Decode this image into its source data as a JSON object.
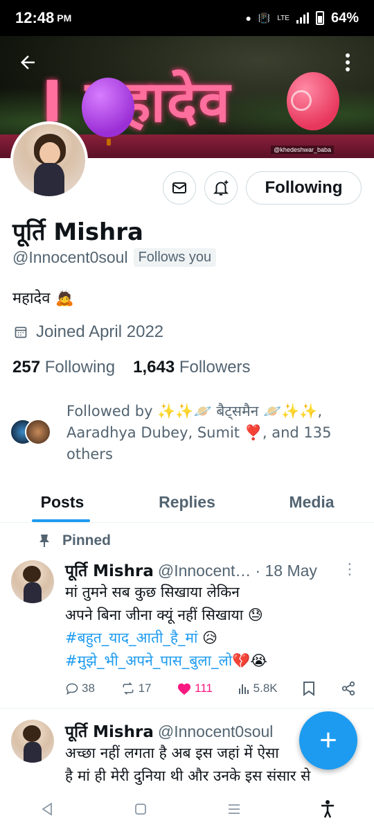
{
  "status_bar": {
    "time": "12:48",
    "ampm": "PM",
    "battery_pct": "64%",
    "network": "LTE"
  },
  "banner": {
    "text": "I  महादेव",
    "watermark": "@khedeshwar_baba"
  },
  "actions": {
    "following_label": "Following"
  },
  "profile": {
    "name": "पूर्ति Mishra",
    "handle": "@Innocent0soul",
    "follows_you": "Follows you",
    "bio": "महादेव 🙇",
    "joined": "Joined April 2022",
    "following_count": "257",
    "following_label": "Following",
    "followers_count": "1,643",
    "followers_label": "Followers",
    "followed_by": "Followed by ✨✨🪐 बैट्समैन 🪐✨✨, Aaradhya Dubey, Sumit ❣️, and 135 others"
  },
  "tabs": [
    {
      "label": "Posts"
    },
    {
      "label": "Replies"
    },
    {
      "label": "Media"
    }
  ],
  "tweets": [
    {
      "pinned_label": "Pinned",
      "name": "पूर्ति Mishra",
      "handle": "@Innocent…",
      "time": "· 18 May",
      "line1": "मां तुमने सब कुछ सिखाया लेकिन",
      "line2": "अपने बिना जीना क्यूं नहीं सिखाया 😓",
      "hashtag1": "#बहुत_याद_आती_है_मां",
      "hashtag1_emoji": " 😥",
      "hashtag2": "#मुझे_भी_अपने_पास_बुला_लो",
      "hashtag2_emoji": "💔😭",
      "replies": "38",
      "retweets": "17",
      "likes": "111",
      "views": "5.8K"
    },
    {
      "name": "पूर्ति Mishra",
      "handle": "@Innocent0soul",
      "line1": "अच्छा नहीं लगता है अब इस जहां में ऐसा",
      "line2": "है मां ही मेरी दुनिया थी और उनके इस संसार से"
    }
  ],
  "colors": {
    "accent": "#1d9bf0",
    "like": "#f91880",
    "muted": "#536471"
  }
}
